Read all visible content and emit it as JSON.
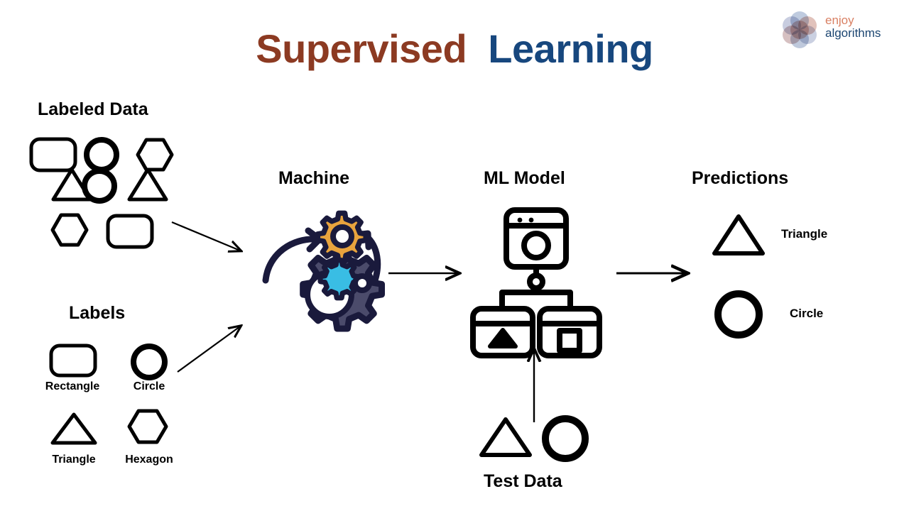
{
  "title": {
    "part_one": "Supervised",
    "part_two": "Learning",
    "color_one": "#8C3A22",
    "color_two": "#17477E"
  },
  "logo": {
    "line_one": "enjoy",
    "line_two": "algorithms",
    "color_one": "#D98063",
    "color_two": "#1B4571"
  },
  "sections": {
    "labeled_data": {
      "heading": "Labeled Data",
      "shapes": [
        "rounded-rectangle",
        "circle",
        "hexagon",
        "triangle",
        "circle",
        "triangle",
        "hexagon",
        "rounded-rectangle"
      ]
    },
    "labels": {
      "heading": "Labels",
      "items": [
        {
          "shape": "rounded-rectangle",
          "label": "Rectangle"
        },
        {
          "shape": "circle",
          "label": "Circle"
        },
        {
          "shape": "triangle",
          "label": "Triangle"
        },
        {
          "shape": "hexagon",
          "label": "Hexagon"
        }
      ]
    },
    "machine": {
      "heading": "Machine",
      "icon": "gears-icon",
      "gear_large_color": "#4B4B6B",
      "gear_orange_color": "#E8A33D",
      "gear_cyan_color": "#39BDE4",
      "gear_outline_color": "#1A1A3C"
    },
    "ml_model": {
      "heading": "ML Model",
      "icon": "ml-model-diagram-icon"
    },
    "predictions": {
      "heading": "Predictions",
      "items": [
        {
          "shape": "triangle",
          "label": "Triangle"
        },
        {
          "shape": "circle",
          "label": "Circle"
        }
      ]
    },
    "test_data": {
      "heading": "Test Data",
      "shapes": [
        "triangle",
        "circle"
      ]
    }
  },
  "arrows": [
    {
      "name": "labeled-data-to-machine",
      "direction": "down-right"
    },
    {
      "name": "labels-to-machine",
      "direction": "up-right"
    },
    {
      "name": "machine-to-ml-model",
      "direction": "right"
    },
    {
      "name": "ml-model-to-predictions",
      "direction": "right"
    },
    {
      "name": "test-data-to-ml-model",
      "direction": "up"
    }
  ]
}
